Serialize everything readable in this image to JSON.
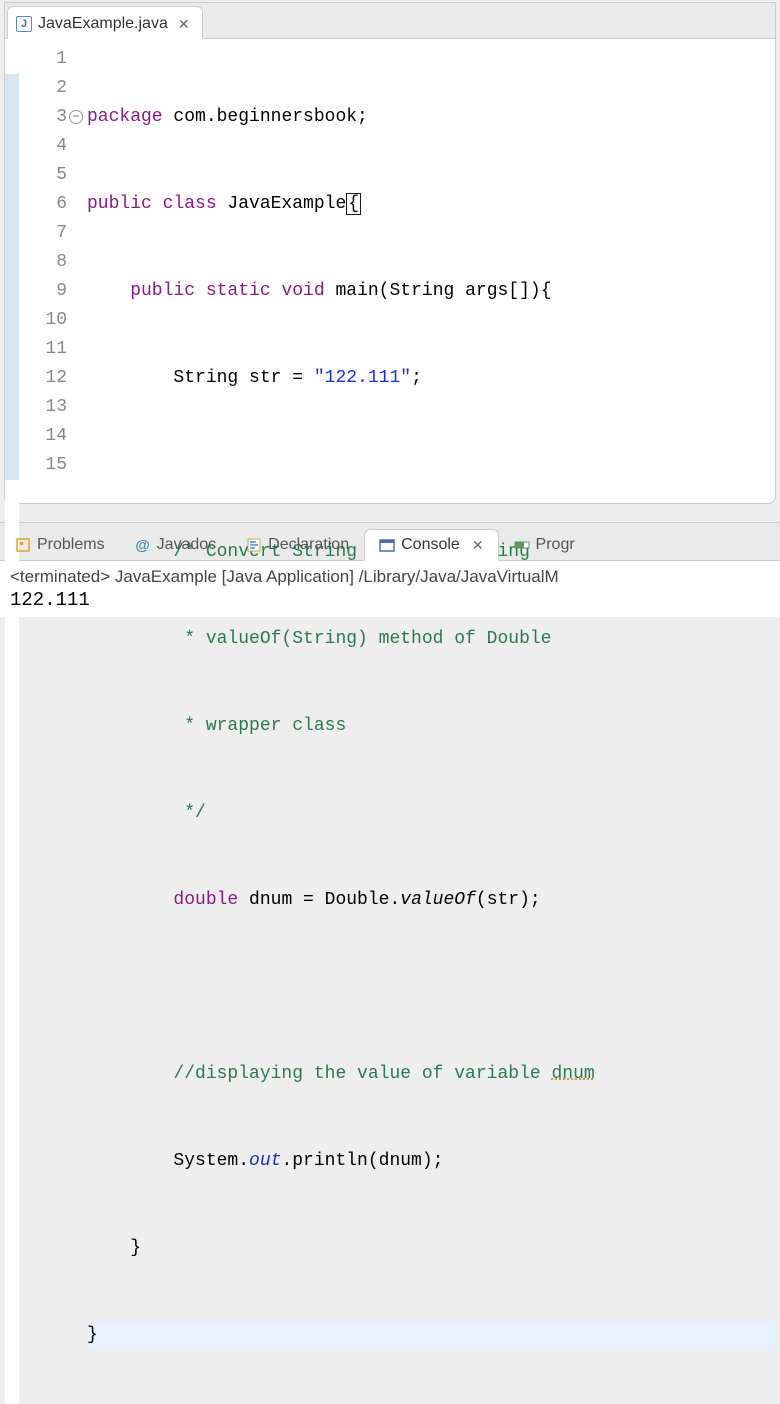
{
  "editor": {
    "tab": {
      "label": "JavaExample.java"
    },
    "lines": [
      {
        "num": "1"
      },
      {
        "num": "2"
      },
      {
        "num": "3"
      },
      {
        "num": "4"
      },
      {
        "num": "5"
      },
      {
        "num": "6"
      },
      {
        "num": "7"
      },
      {
        "num": "8"
      },
      {
        "num": "9"
      },
      {
        "num": "10"
      },
      {
        "num": "11"
      },
      {
        "num": "12"
      },
      {
        "num": "13"
      },
      {
        "num": "14"
      },
      {
        "num": "15"
      }
    ],
    "code": {
      "l1_kw1": "package",
      "l1_pkg": " com.beginnersbook;",
      "l2_kw1": "public",
      "l2_kw2": " class",
      "l2_cls": " JavaExample",
      "l2_brace": "{",
      "l3_kw1": "    public",
      "l3_kw2": " static",
      "l3_kw3": " void",
      "l3_main": " main(String args[]){",
      "l4_txt": "        String str = ",
      "l4_str": "\"122.111\"",
      "l4_semi": ";",
      "l5_txt": "",
      "l6_cmt": "        /* Convert String to double using",
      "l7_cmt": "         * valueOf(String) method of Double",
      "l8_cmt": "         * wrapper class",
      "l9_cmt": "         */",
      "l10_kw": "        double",
      "l10_txt": " dnum = Double.",
      "l10_valof": "valueOf",
      "l10_rest": "(str);",
      "l11_txt": "",
      "l12_cmt1": "        //displaying the value of variable ",
      "l12_warn": "dnum",
      "l13_txt1": "        System.",
      "l13_out": "out",
      "l13_txt2": ".println(dnum);",
      "l14_txt": "    }",
      "l15_txt": "}"
    }
  },
  "bottomTabs": {
    "problems": "Problems",
    "javadoc": "Javadoc",
    "declaration": "Declaration",
    "console": "Console",
    "progress": "Progr"
  },
  "console": {
    "status": "<terminated> JavaExample [Java Application] /Library/Java/JavaVirtualM",
    "output": "122.111"
  }
}
